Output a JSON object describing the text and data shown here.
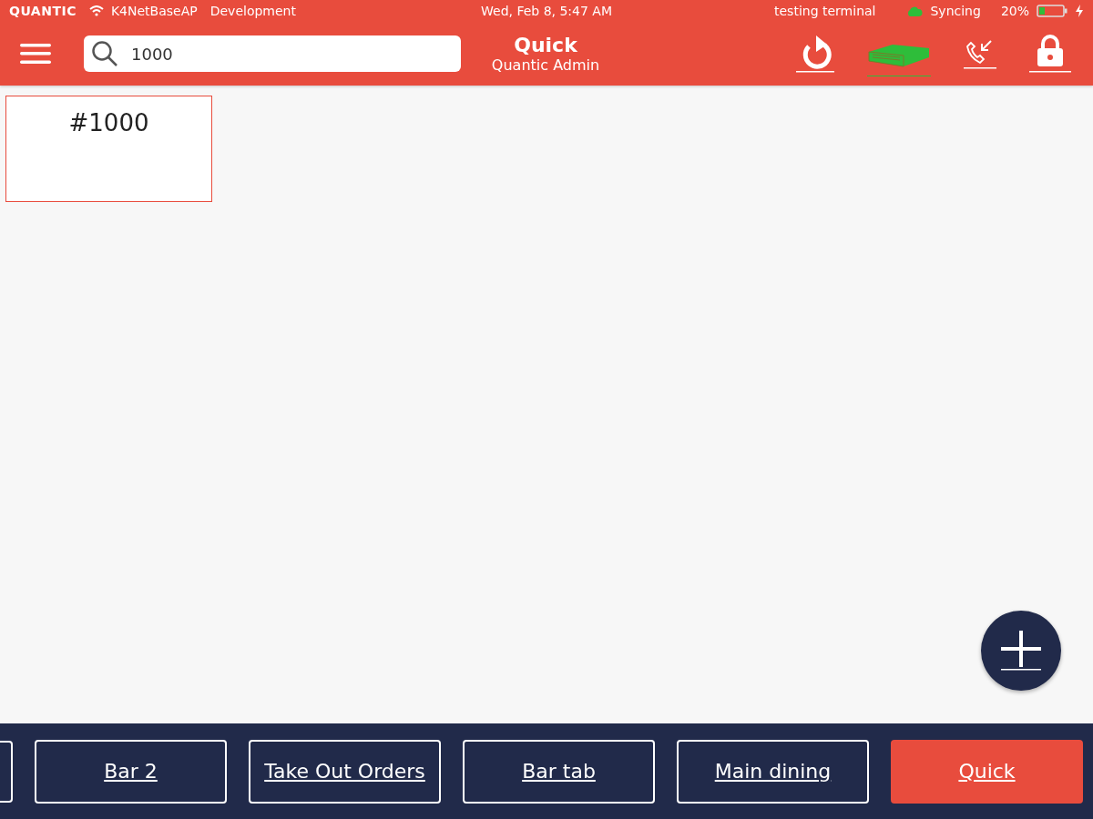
{
  "status_bar": {
    "brand": "QUANTIC",
    "network": "K4NetBaseAP",
    "environment": "Development",
    "datetime": "Wed, Feb 8, 5:47 AM",
    "terminal": "testing terminal",
    "sync": "Syncing",
    "battery": "20%"
  },
  "header": {
    "search": {
      "value": "1000"
    },
    "title": "Quick",
    "subtitle": "Quantic Admin"
  },
  "orders": [
    {
      "label": "#1000"
    }
  ],
  "tabs": [
    {
      "label": "Bar 2",
      "selected": false
    },
    {
      "label": "Take Out Orders",
      "selected": false
    },
    {
      "label": "Bar tab",
      "selected": false
    },
    {
      "label": "Main dining",
      "selected": false
    },
    {
      "label": "Quick",
      "selected": true
    }
  ]
}
